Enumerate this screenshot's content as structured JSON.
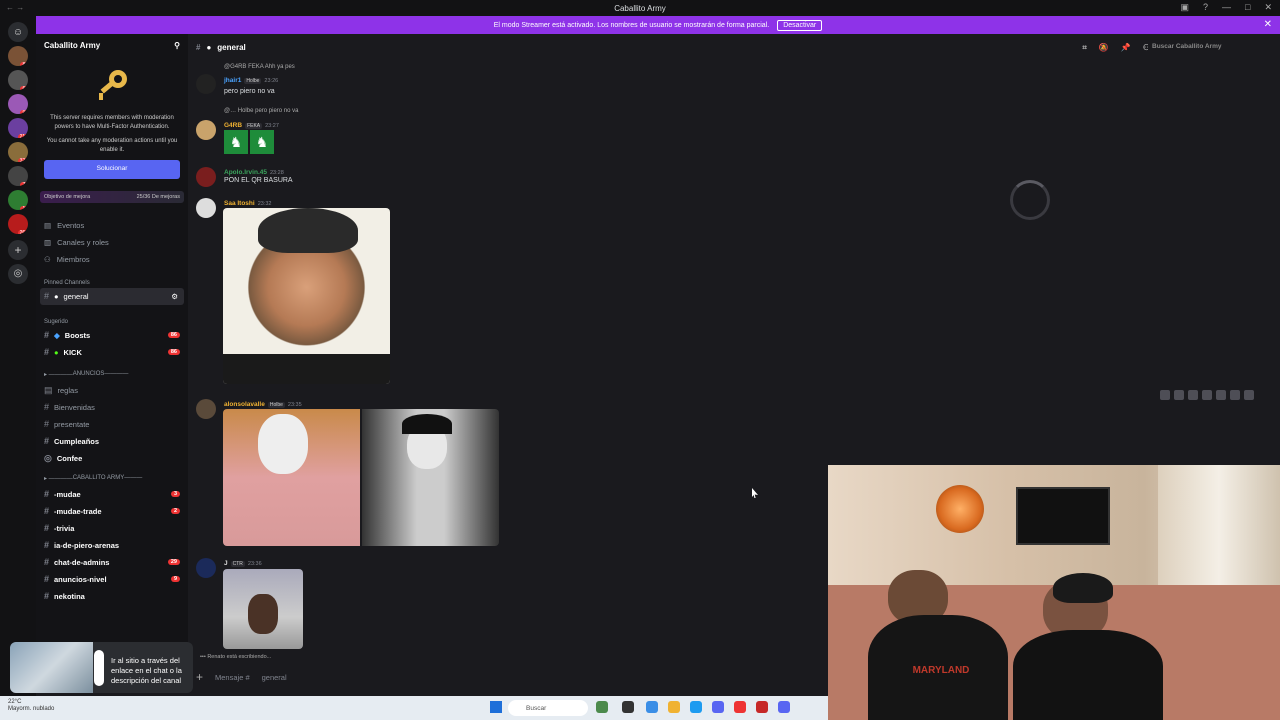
{
  "window": {
    "title": "Caballito Army"
  },
  "banner": {
    "text": "El modo Streamer está activado. Los nombres de usuario se mostrarán de forma parcial.",
    "button": "Desactivar"
  },
  "server": {
    "name": "Caballito Army",
    "mfa_text": "This server requires members with moderation powers to have Multi-Factor Authentication.",
    "mfa_sub": "You cannot take any moderation actions until you enable it.",
    "mfa_button": "Solucionar",
    "boost_label": "Objetivo de mejora",
    "boost_value": "25/36 De mejoras",
    "nav": [
      "Eventos",
      "Canales y roles",
      "Miembros"
    ],
    "pinned_label": "Pinned Channels",
    "pinned_channel": "general",
    "suggested_label": "Sugerido",
    "suggested": [
      {
        "name": "Boosts",
        "badge": "86"
      },
      {
        "name": "KICK",
        "badge": "86"
      }
    ],
    "cat_anuncios": "ANUNCIOS",
    "anuncios": [
      {
        "name": "reglas",
        "bold": false
      },
      {
        "name": "Bienvenidas",
        "bold": false
      },
      {
        "name": "presentate",
        "bold": false
      },
      {
        "name": "Cumpleaños",
        "bold": true
      },
      {
        "name": "Confee",
        "bold": true
      }
    ],
    "cat_caballito": "CABALLITO ARMY",
    "caballito": [
      {
        "name": "-mudae",
        "badge": "3"
      },
      {
        "name": "-mudae-trade",
        "badge": "2"
      },
      {
        "name": "-trivia",
        "badge": ""
      },
      {
        "name": "ia-de-piero-arenas",
        "badge": ""
      },
      {
        "name": "chat-de-admins",
        "badge": "29"
      },
      {
        "name": "anuncios-nivel",
        "badge": "9"
      },
      {
        "name": "nekotina",
        "badge": ""
      }
    ]
  },
  "server_badges": [
    "88",
    "60",
    "95",
    "216",
    "324",
    "76",
    "10",
    "264"
  ],
  "channel": {
    "name": "general",
    "search_placeholder": "Buscar Caballito Army"
  },
  "messages": [
    {
      "reply": "@G4RB  FEKA  Ahh ya pes",
      "user": "jhair1",
      "tag": "Holbe",
      "time": "23:26",
      "text": "pero piero no va",
      "color": "#4aa3ff"
    },
    {
      "reply": "@…  Holbe  pero piero no va",
      "user": "G4RB",
      "tag": "FEKA",
      "time": "23:27",
      "text": "",
      "color": "#f0b232"
    },
    {
      "reply": "",
      "user": "Apolo.Irvin.45",
      "tag": "",
      "time": "23:28",
      "text": "PON EL QR BASURA",
      "color": "#3ba55d"
    },
    {
      "reply": "",
      "user": "Saa Itoshi",
      "tag": "",
      "time": "23:32",
      "text": "",
      "color": "#f0b232"
    },
    {
      "reply": "",
      "user": "alonsolavalle",
      "tag": "Holbe",
      "time": "23:35",
      "text": "",
      "color": "#f0b232"
    },
    {
      "reply": "",
      "user": "J",
      "tag": "CTR",
      "time": "23:36",
      "text": "",
      "color": "#ddd"
    }
  ],
  "typing": "Renato está escribiendo...",
  "composer": {
    "placeholder": "Mensaje #",
    "channel": "general"
  },
  "toast": {
    "text": "Ir al sitio a través del enlace en el chat o la descripción del canal"
  },
  "taskbar": {
    "temp": "22°C",
    "weather": "Mayorm. nublado",
    "search": "Buscar"
  },
  "camera": {
    "shirt_text": "MARYLAND"
  }
}
